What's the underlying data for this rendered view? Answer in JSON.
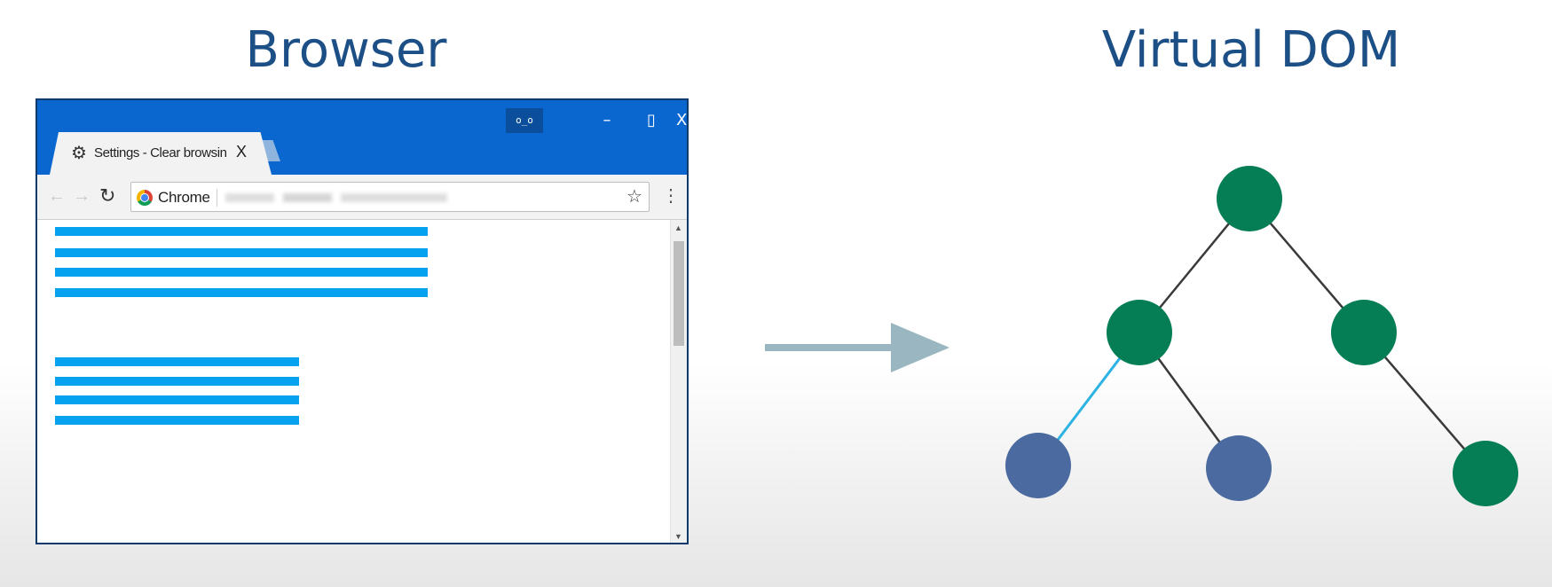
{
  "headings": {
    "left": "Browser",
    "right": "Virtual DOM"
  },
  "browser": {
    "tab": {
      "title": "Settings - Clear browsing data",
      "icon": "gear-icon",
      "close_glyph": "X"
    },
    "window_controls": {
      "user_badge": "o_o",
      "minimize": "–",
      "maximize": "▯",
      "close": "X"
    },
    "omnibox": {
      "site_label": "Chrome",
      "url": "chrome://settings/clearBrowserData"
    },
    "colors": {
      "titlebar": "#0b67d0",
      "content_lines": "#05a2ef"
    }
  },
  "virtual_dom": {
    "colors": {
      "element_node": "#057e55",
      "changed_node": "#4b6a9f",
      "edge": "#3a3a3a",
      "highlighted_edge": "#2db3e3",
      "arrow": "#9ab6c0"
    }
  }
}
